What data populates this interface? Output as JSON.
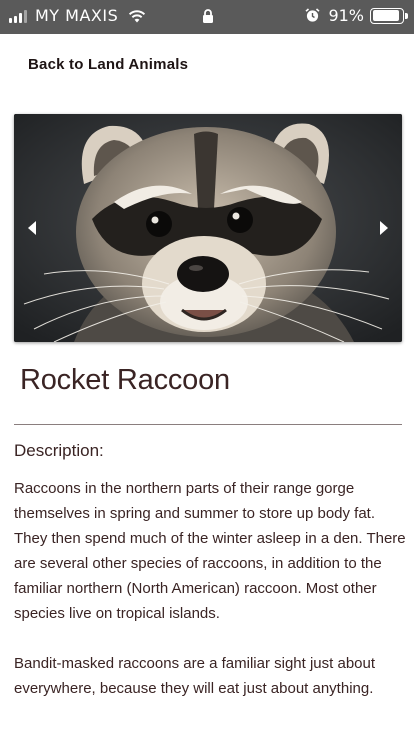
{
  "status_bar": {
    "carrier": "MY MAXIS",
    "battery_percent": "91%",
    "battery_level": 0.91,
    "icons": [
      "signal-icon",
      "wifi-icon",
      "lock-icon",
      "alarm-icon",
      "battery-icon"
    ]
  },
  "nav": {
    "back_label": "Back to Land Animals"
  },
  "carousel": {
    "image_subject": "raccoon",
    "prev_icon": "arrow-left-icon",
    "next_icon": "arrow-right-icon"
  },
  "animal": {
    "name": "Rocket Raccoon",
    "description_heading": "Description:",
    "paragraphs": [
      "Raccoons in the northern parts of their range gorge themselves in spring and summer to store up body fat. They then spend much of the winter asleep in a den. There are several other species of raccoons, in addition to the familiar northern (North American) raccoon. Most other species live on tropical islands.",
      "Bandit-masked raccoons are a familiar sight just about everywhere, because they will eat just about anything."
    ]
  },
  "colors": {
    "status_bar_bg": "#5a5a5a",
    "text": "#3a2424",
    "divider": "#8a7e7e"
  }
}
